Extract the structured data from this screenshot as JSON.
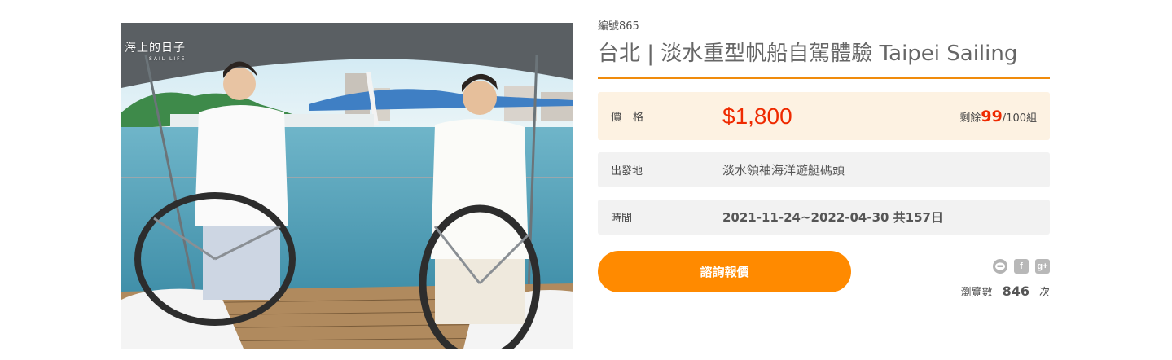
{
  "photo": {
    "alt": "台北 | 淡水重型帆船自駕體驗 Taipei Sailing",
    "watermark_title": "海上的日子",
    "watermark_sub": "SAIL LIFE"
  },
  "product": {
    "code": "編號865",
    "title": "台北 | 淡水重型帆船自駕體驗 Taipei Sailing"
  },
  "price_row": {
    "label": "價格",
    "price": "$1,800",
    "stock_prefix": "剩餘",
    "stock_remaining": "99",
    "stock_suffix": "/100組"
  },
  "origin_row": {
    "label": "出發地",
    "value": "淡水領袖海洋遊艇碼頭"
  },
  "time_row": {
    "label": "時間",
    "value": "2021-11-24~2022-04-30 共157日"
  },
  "cta": {
    "label": "諮詢報價"
  },
  "share": {
    "icons": [
      "line-icon",
      "facebook-icon",
      "google-plus-icon"
    ],
    "line_glyph": "LINE",
    "facebook_glyph": "f",
    "google_glyph": "g+"
  },
  "views": {
    "prefix": "瀏覽數",
    "count": "846",
    "suffix": "次"
  },
  "colors": {
    "accent": "#ff8a00",
    "rule": "#f08b0c",
    "price": "#ee2a00",
    "price_bg": "#fdf2e2",
    "row_bg": "#f2f2f2"
  }
}
